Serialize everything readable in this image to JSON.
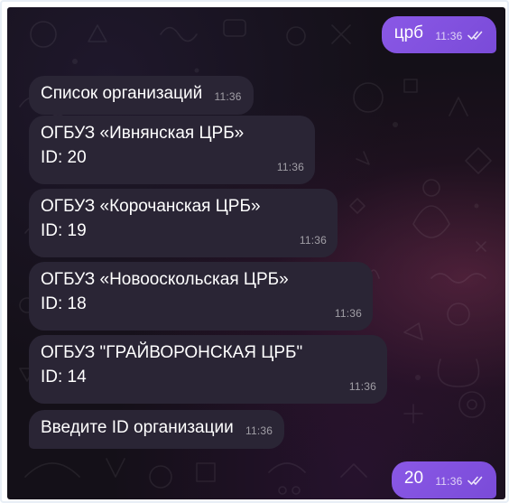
{
  "chat": {
    "messages": [
      {
        "direction": "out",
        "text": "црб",
        "time": "11:36",
        "status": "read"
      },
      {
        "direction": "in",
        "text": "Список организаций",
        "time": "11:36"
      },
      {
        "direction": "in",
        "line1": "ОГБУЗ «Ивнянская ЦРБ»",
        "line2": "ID: 20",
        "time": "11:36"
      },
      {
        "direction": "in",
        "line1": "ОГБУЗ «Корочанская ЦРБ»",
        "line2": "ID: 19",
        "time": "11:36"
      },
      {
        "direction": "in",
        "line1": "ОГБУЗ «Новооскольская ЦРБ»",
        "line2": "ID: 18",
        "time": "11:36"
      },
      {
        "direction": "in",
        "line1": "ОГБУЗ \"ГРАЙВОРОНСКАЯ ЦРБ\"",
        "line2": "ID: 14",
        "time": "11:36"
      },
      {
        "direction": "in",
        "text": "Введите ID организации",
        "time": "11:36"
      },
      {
        "direction": "out",
        "text": "20",
        "time": "11:36",
        "status": "read"
      }
    ]
  },
  "colors": {
    "background": "#141018",
    "incoming_bubble": "#2a2535",
    "outgoing_bubble": "#8a58e6"
  },
  "icons": {
    "read_status": "double-check-icon",
    "wallpaper": "doodle-pattern"
  }
}
